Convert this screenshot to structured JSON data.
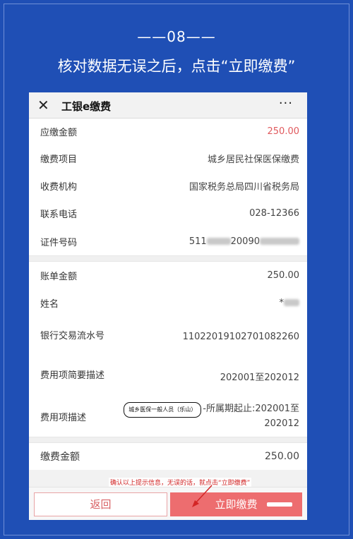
{
  "header": {
    "step": "——08——",
    "headline": "核对数据无误之后，点击“立即缴费”"
  },
  "app": {
    "close_icon": "close-icon",
    "title": "工银e缴费",
    "more": "···"
  },
  "section1": [
    {
      "label": "应缴金额",
      "value": "250.00"
    },
    {
      "label": "缴费项目",
      "value": "城乡居民社保医保缴费"
    },
    {
      "label": "收费机构",
      "value": "国家税务总局四川省税务局"
    },
    {
      "label": "联系电话",
      "value": "028-12366"
    },
    {
      "label": "证件号码",
      "value_prefix": "511",
      "value_mid": "20090"
    }
  ],
  "section2": {
    "bill_label": "账单金额",
    "bill_value": "250.00",
    "name_label": "姓名",
    "name_value": "*",
    "txn_label": "银行交易流水号",
    "txn_value": "11022019102701082260",
    "brief_label": "费用项简要描述",
    "brief_value": "202001至202012",
    "desc_label": "费用项描述",
    "desc_oval": "城乡医保一般人员（乐山）",
    "desc_value": "-所属期起止:202001至202012"
  },
  "section3": {
    "label": "缴费金额",
    "value": "250.00"
  },
  "footer": {
    "back": "返回",
    "pay": "立即缴费"
  },
  "annotation": "确认以上提示信息，无误的话，就点击“立即缴费”",
  "colors": {
    "background": "#1f4fb5",
    "accent": "#ed6d6f",
    "amount_red": "#e0595d"
  }
}
